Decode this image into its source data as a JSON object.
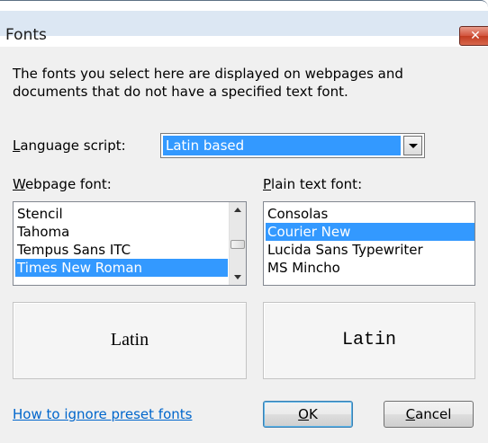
{
  "window": {
    "title": "Fonts",
    "close_glyph": "✕"
  },
  "intro_text": "The fonts you select here are displayed on webpages and\ndocuments that do not have a specified text font.",
  "language_script": {
    "label_access_key": "L",
    "label_rest": "anguage script:",
    "value": "Latin based"
  },
  "webpage_font": {
    "label_access_key": "W",
    "label_rest": "ebpage font:",
    "items": [
      "Stencil",
      "Tahoma",
      "Tempus Sans ITC",
      "Times New Roman"
    ],
    "selected": "Times New Roman",
    "preview": "Latin"
  },
  "plain_text_font": {
    "label_access_key": "P",
    "label_rest": "lain text font:",
    "items": [
      "Consolas",
      "Courier New",
      "Lucida Sans Typewriter",
      "MS Mincho"
    ],
    "selected": "Courier New",
    "preview": "Latin"
  },
  "help_link": "How to ignore preset fonts",
  "buttons": {
    "ok_access_key": "O",
    "ok_rest": "K",
    "cancel_access_key": "C",
    "cancel_rest": "ancel"
  },
  "colors": {
    "selection": "#3399ff",
    "link": "#0066cc",
    "dialog_bg": "#f0f0f0"
  }
}
